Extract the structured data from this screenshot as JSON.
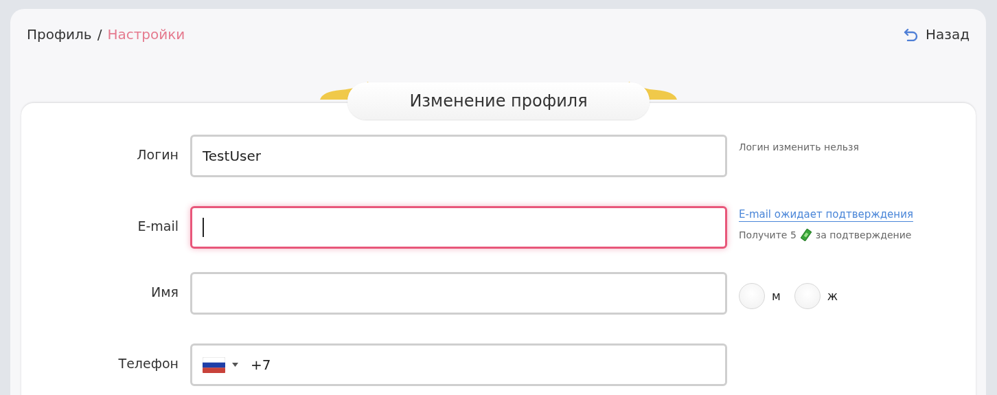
{
  "breadcrumb": [
    {
      "label": "Профиль",
      "kind": "link"
    },
    {
      "label": "/",
      "kind": "separator"
    },
    {
      "label": "Настройки",
      "kind": "current"
    }
  ],
  "back_button": {
    "label": "Назад"
  },
  "card": {
    "title": "Изменение профиля"
  },
  "fields": [
    {
      "kind": "text",
      "label": "Логин",
      "value": "TestUser",
      "focused": false,
      "note": "Логин изменить нельзя"
    },
    {
      "kind": "email",
      "label": "E-mail",
      "focused": true,
      "link": "E-mail ожидает подтверждения",
      "reward_before": "Получите 5",
      "reward_after": "за подтверждение"
    },
    {
      "kind": "name",
      "label": "Имя",
      "focused": false,
      "options": [
        {
          "label": "м",
          "selected": false
        },
        {
          "label": "ж",
          "selected": false
        }
      ]
    },
    {
      "kind": "phone",
      "label": "Телефон",
      "value": "+7",
      "focused": false
    }
  ]
}
